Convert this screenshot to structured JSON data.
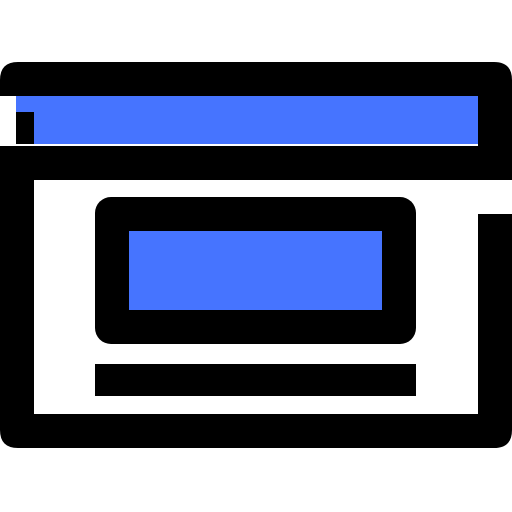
{
  "icon": {
    "name": "browser-window-icon",
    "colors": {
      "outline": "#000000",
      "accent": "#4674ff",
      "background": "#ffffff"
    }
  }
}
